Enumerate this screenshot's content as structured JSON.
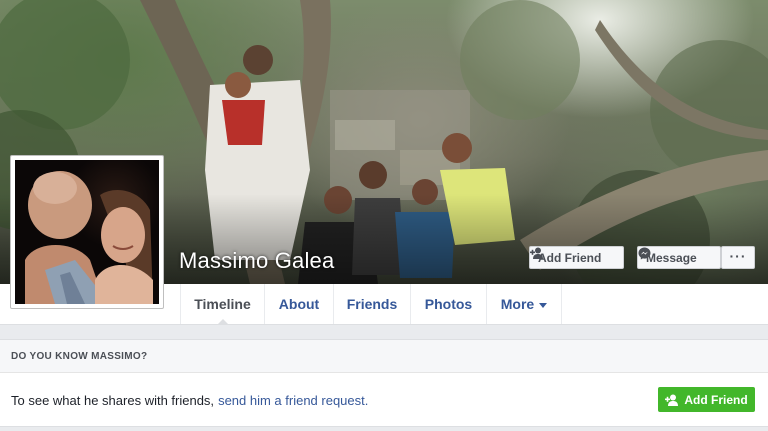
{
  "profile": {
    "name": "Massimo Galea"
  },
  "cover_actions": {
    "add_friend": "Add Friend",
    "message": "Message",
    "more": "···"
  },
  "tabs": [
    {
      "label": "Timeline",
      "active": true
    },
    {
      "label": "About"
    },
    {
      "label": "Friends"
    },
    {
      "label": "Photos"
    },
    {
      "label": "More"
    }
  ],
  "know": {
    "header": "DO YOU KNOW MASSIMO?",
    "text": "To see what he shares with friends,",
    "link": "send him a friend request.",
    "button": "Add Friend"
  },
  "colors": {
    "link_blue": "#365899",
    "green": "#42b72a",
    "background": "#e9ebee"
  }
}
